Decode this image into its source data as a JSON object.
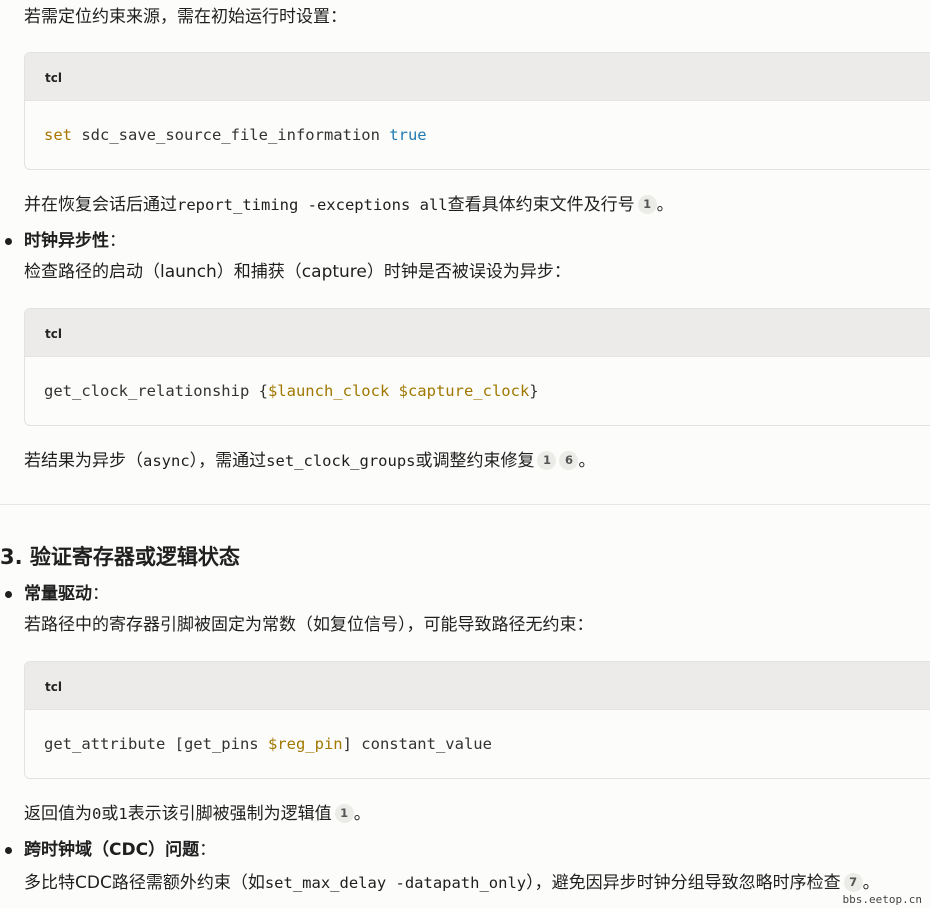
{
  "p1": "若需定位约束来源，需在初始运行时设置：",
  "code1": {
    "lang": "tcl",
    "kw": "set",
    "rest": " sdc_save_source_file_information ",
    "lit": "true"
  },
  "p2": {
    "before": "并在恢复会话后通过",
    "code": "report_timing -exceptions all",
    "after": "查看具体约束文件及行号",
    "cite": "1",
    "end": "。"
  },
  "bullet1": {
    "title": "时钟异步性",
    "colon": "：",
    "desc": "检查路径的启动（launch）和捕获（capture）时钟是否被误设为异步："
  },
  "code2": {
    "lang": "tcl",
    "cmd": "get_clock_relationship {",
    "var1": "$launch_clock",
    "space": " ",
    "var2": "$capture_clock",
    "close": "}"
  },
  "p3": {
    "before": "若结果为异步（",
    "code1": "async",
    "mid": "），需通过",
    "code2": "set_clock_groups",
    "after": "或调整约束修复",
    "cite1": "1",
    "cite2": "6",
    "end": "。"
  },
  "section3": "3. 验证寄存器或逻辑状态",
  "bullet2": {
    "title": "常量驱动",
    "colon": "：",
    "desc": "若路径中的寄存器引脚被固定为常数（如复位信号），可能导致路径无约束："
  },
  "code3": {
    "lang": "tcl",
    "cmd": "get_attribute [get_pins ",
    "var": "$reg_pin",
    "rest": "] constant_value"
  },
  "p4": {
    "before": "返回值为",
    "c0": "0",
    "or": "或",
    "c1": "1",
    "after": "表示该引脚被强制为逻辑值",
    "cite": "1",
    "end": "。"
  },
  "bullet3": {
    "title": "跨时钟域（CDC）问题",
    "colon": "：",
    "before": "多比特CDC路径需额外约束（如",
    "code": "set_max_delay -datapath_only",
    "after": "），避免因异步时钟分组导致忽略时序检查",
    "cite": "7",
    "end": "。"
  },
  "watermark": "bbs.eetop.cn"
}
